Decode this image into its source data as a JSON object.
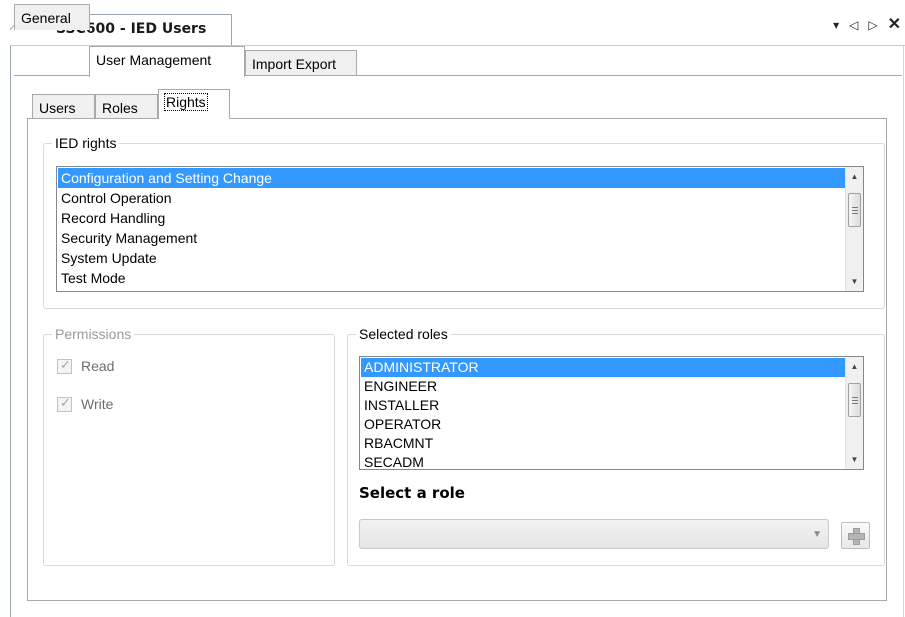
{
  "document_tab": {
    "title": "SSC600 - IED Users"
  },
  "window_controls": {
    "menu_glyph": "▾",
    "prev_glyph": "◁",
    "next_glyph": "▷",
    "close_glyph": "✕"
  },
  "main_tabs": [
    {
      "label": "General",
      "active": false
    },
    {
      "label": "User Management",
      "active": true
    },
    {
      "label": "Import Export",
      "active": false
    }
  ],
  "sub_tabs": [
    {
      "label": "Users",
      "active": false
    },
    {
      "label": "Roles",
      "active": false
    },
    {
      "label": "Rights",
      "active": true
    }
  ],
  "ied_rights": {
    "group_label": "IED rights",
    "items": [
      "Configuration and Setting Change",
      "Control Operation",
      "Record Handling",
      "Security Management",
      "System Update",
      "Test Mode"
    ],
    "selected_index": 0
  },
  "permissions": {
    "group_label": "Permissions",
    "disabled": true,
    "options": [
      {
        "label": "Read",
        "checked": true
      },
      {
        "label": "Write",
        "checked": true
      }
    ]
  },
  "selected_roles": {
    "group_label": "Selected roles",
    "items": [
      "ADMINISTRATOR",
      "ENGINEER",
      "INSTALLER",
      "OPERATOR",
      "RBACMNT",
      "SECADM"
    ],
    "selected_index": 0
  },
  "select_role": {
    "label": "Select a role",
    "value": ""
  },
  "colors": {
    "selection": "#3399ff",
    "border": "#a9a9a9",
    "disabled_text": "#9a9a9a"
  }
}
